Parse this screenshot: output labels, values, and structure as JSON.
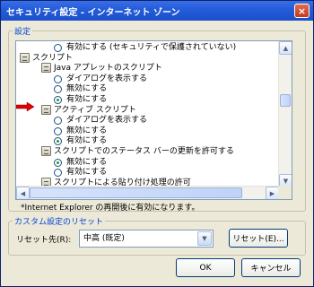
{
  "window": {
    "title": "セキュリティ設定 - インターネット ゾーン",
    "close_label": "×"
  },
  "settings_group": {
    "label": "設定",
    "rows": [
      {
        "kind": "radio",
        "checked": false,
        "text": "有効にする (セキュリティで保護されていない)"
      },
      {
        "kind": "folder",
        "text": "スクリプト"
      },
      {
        "kind": "folder",
        "text": "Java アプレットのスクリプト"
      },
      {
        "kind": "radio",
        "checked": false,
        "text": "ダイアログを表示する"
      },
      {
        "kind": "radio",
        "checked": false,
        "text": "無効にする"
      },
      {
        "kind": "radio",
        "checked": true,
        "text": "有効にする"
      },
      {
        "kind": "folder",
        "text": "アクティブ スクリプト"
      },
      {
        "kind": "radio",
        "checked": false,
        "text": "ダイアログを表示する"
      },
      {
        "kind": "radio",
        "checked": false,
        "text": "無効にする"
      },
      {
        "kind": "radio",
        "checked": true,
        "text": "有効にする"
      },
      {
        "kind": "folder",
        "text": "スクリプトでのステータス バーの更新を許可する"
      },
      {
        "kind": "radio",
        "checked": true,
        "text": "無効にする"
      },
      {
        "kind": "radio",
        "checked": false,
        "text": "有効にする"
      },
      {
        "kind": "folder",
        "text": "スクリプトによる貼り付け処理の許可"
      }
    ],
    "footnote": "*Internet Explorer の再開後に有効になります。"
  },
  "reset_group": {
    "label": "カスタム設定のリセット",
    "reset_to_label": "リセット先(R):",
    "selected_level": "中高 (既定)",
    "reset_button": "リセット(E)..."
  },
  "ok_button": "OK",
  "cancel_button": "キャンセル",
  "colors": {
    "title_bar": "#245ddb",
    "group_label": "#0046d5",
    "arrow": "#e00000"
  }
}
